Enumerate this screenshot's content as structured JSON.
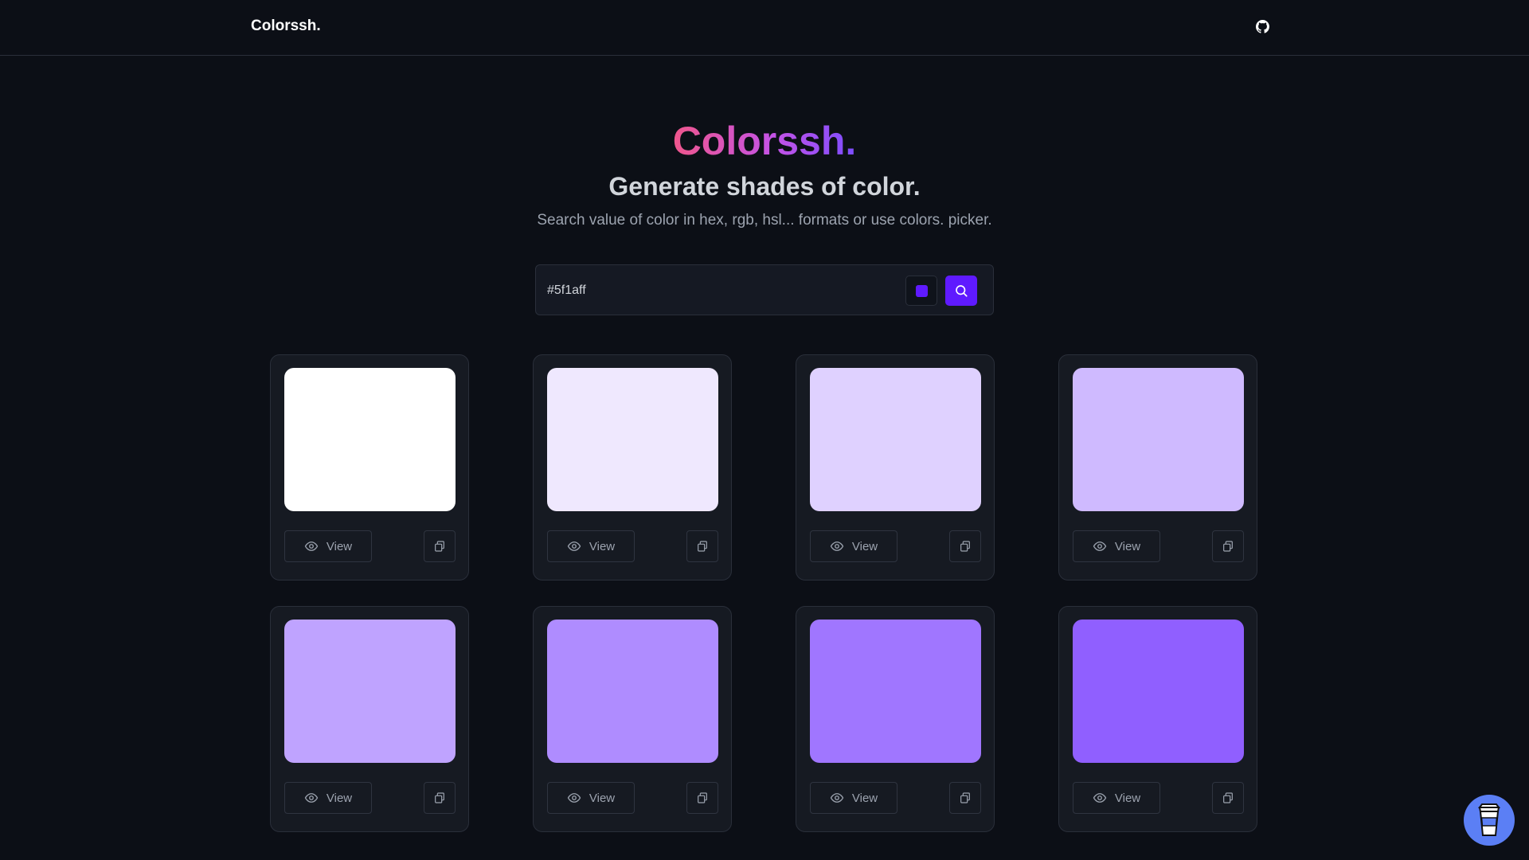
{
  "nav": {
    "brand": "Colorssh.",
    "github_icon": "github-icon"
  },
  "hero": {
    "title": "Colorssh.",
    "subtitle": "Generate shades of color.",
    "description": "Search value of color in hex, rgb, hsl... formats or use colors. picker."
  },
  "search": {
    "value": "#5f1aff",
    "picker_color": "#5f1aff",
    "button_color": "#5f1aff",
    "search_icon": "search-icon"
  },
  "cards": [
    {
      "color": "#ffffff",
      "view_label": "View"
    },
    {
      "color": "#efe8fe",
      "view_label": "View"
    },
    {
      "color": "#dfd1ff",
      "view_label": "View"
    },
    {
      "color": "#cfbaff",
      "view_label": "View"
    },
    {
      "color": "#bfa3ff",
      "view_label": "View"
    },
    {
      "color": "#af8cff",
      "view_label": "View"
    },
    {
      "color": "#a076ff",
      "view_label": "View"
    },
    {
      "color": "#905fff",
      "view_label": "View"
    }
  ],
  "floating": {
    "icon": "coffee-cup-icon",
    "color": "#5b7ff5"
  }
}
